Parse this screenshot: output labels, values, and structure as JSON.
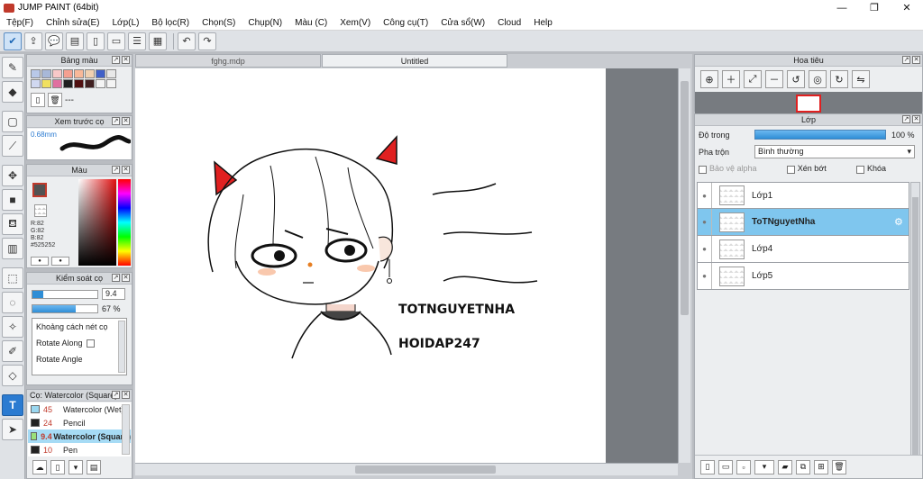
{
  "window": {
    "title": "JUMP PAINT (64bit)"
  },
  "menu": [
    "Tệp(F)",
    "Chỉnh sửa(E)",
    "Lớp(L)",
    "Bộ lọc(R)",
    "Chọn(S)",
    "Chụp(N)",
    "Màu (C)",
    "Xem(V)",
    "Công cụ(T)",
    "Cửa sổ(W)",
    "Cloud",
    "Help"
  ],
  "colors": {
    "accent": "#2b7bd1",
    "selected_layer": "#7fc6ee",
    "horns": "#e02020"
  },
  "panels": {
    "palette": {
      "title": "Bảng màu",
      "dashes": "---"
    },
    "brush_preview": {
      "title": "Xem trước cọ",
      "size": "0.68mm"
    },
    "color": {
      "title": "Màu",
      "r": "R:82",
      "g": "G:82",
      "b": "B:82",
      "hex": "#525252"
    },
    "brush_control": {
      "title": "Kiểm soát cọ",
      "size": "9.4",
      "opacity": "67 %",
      "opacity_fill": 0.67,
      "options": [
        "Khoảng cách nét cọ",
        "Rotate Along",
        "Rotate Angle"
      ]
    },
    "brush_list": {
      "title": "Cọ: Watercolor (Square)",
      "items": [
        {
          "size": "45",
          "name": "Watercolor (Wet)"
        },
        {
          "size": "24",
          "name": "Pencil"
        },
        {
          "size": "9.4",
          "name": "Watercolor (Square)"
        },
        {
          "size": "10",
          "name": "Pen"
        }
      ]
    }
  },
  "canvas": {
    "tabs": [
      "fghg.mdp",
      "Untitled"
    ],
    "text1": "TOTNGUYETNHA",
    "text2": "HOIDAP247"
  },
  "navigator": {
    "title": "Hoa tiêu"
  },
  "layers": {
    "title": "Lớp",
    "opacity_label": "Độ trong",
    "opacity_value": "100 %",
    "blend_label": "Pha trộn",
    "blend_value": "Bình thường",
    "protect_alpha": "Bảo vệ alpha",
    "clipping": "Xén bớt",
    "lock": "Khóa",
    "items": [
      {
        "name": "Lớp1",
        "selected": false
      },
      {
        "name": "ToTNguyetNha",
        "selected": true
      },
      {
        "name": "Lớp4",
        "selected": false
      },
      {
        "name": "Lớp5",
        "selected": false
      }
    ]
  }
}
